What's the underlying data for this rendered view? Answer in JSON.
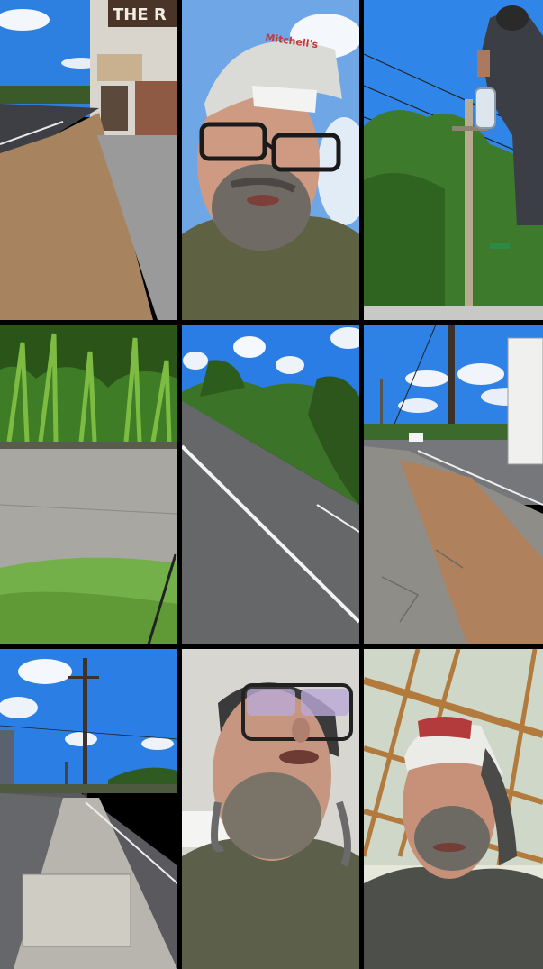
{
  "layout": {
    "rows": 3,
    "columns": 3
  },
  "tiles": [
    {
      "scene": "storefront-sidewalk",
      "sign_text": "THE R"
    },
    {
      "scene": "selfie-cap-glasses",
      "cap_text": "Mitchell's"
    },
    {
      "scene": "man-pole-trees"
    },
    {
      "scene": "weeds-curb"
    },
    {
      "scene": "road-lane-hill"
    },
    {
      "scene": "sidewalk-truck-road"
    },
    {
      "scene": "street-poles"
    },
    {
      "scene": "selfie-low-angle"
    },
    {
      "scene": "selfie-shelter"
    }
  ],
  "colors": {
    "sky": "#2a7be0",
    "foliage": "#3f7d2a",
    "asphalt": "#6e6e70",
    "dirt": "#a9876a",
    "shirt": "#5c5f45"
  }
}
